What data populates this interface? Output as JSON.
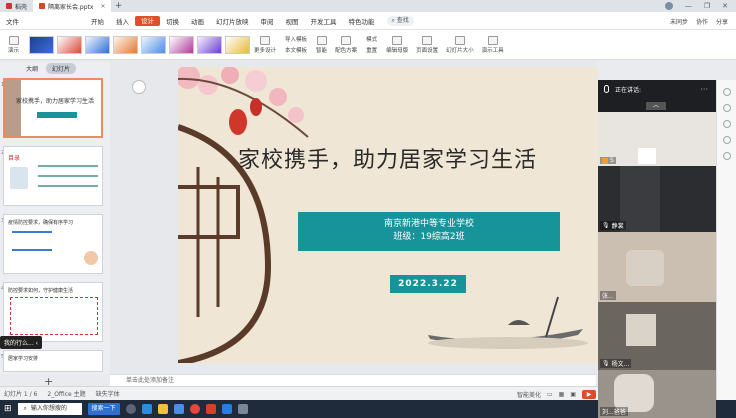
{
  "tabs": [
    {
      "label": "稻壳",
      "active": false
    },
    {
      "label": "隔离家长会.pptx",
      "active": true
    }
  ],
  "menus": [
    "文件",
    "开始",
    "插入",
    "设计",
    "切换",
    "动画",
    "幻灯片放映",
    "审阅",
    "视图",
    "开发工具",
    "特色功能"
  ],
  "active_menu": "设计",
  "search_label": "查找",
  "menu_right": {
    "unsaved": "未同步",
    "collab": "协作",
    "share": "分享"
  },
  "ribbon": {
    "left_label": "演示",
    "more_design": "更多设计",
    "import_template": "导入模板",
    "text_template": "本文模板",
    "smart": "智能",
    "color_scheme": "配色方案",
    "format": "模式",
    "reset": "重置",
    "edit_master": "编辑母版",
    "page_setup": "页面设置",
    "slide_size": "幻灯片大小",
    "show_tools": "演示工具"
  },
  "panel": {
    "outline": "大纲",
    "slides": "幻灯片"
  },
  "thumbnails": [
    {
      "num": "1",
      "title": "家校携手，助力居家学习生活"
    },
    {
      "num": "2",
      "title": "目录"
    },
    {
      "num": "3",
      "title": "疫情防控要求，确保有序学习"
    },
    {
      "num": "4",
      "title": "防控要求如何，守护健康生活"
    },
    {
      "num": "5",
      "title": "居家学习安排"
    }
  ],
  "float_tip": "我的行么...",
  "slide": {
    "title": "家校携手，助力居家学习生活",
    "school": "南京新港中等专业学校",
    "class": "班级：19综高2班",
    "date": "2022.3.22"
  },
  "notes_placeholder": "单击此处添加备注",
  "status": {
    "slide_count": "幻灯片 1 / 6",
    "theme": "2_Office 主题",
    "font_missing": "缺失字体",
    "smart_beautify": "智能美化"
  },
  "meeting": {
    "header": "正在讲话:",
    "participants": [
      {
        "name": "S",
        "label": "s"
      },
      {
        "name": "静裳"
      },
      {
        "name": "张..."
      },
      {
        "name": "杨文..."
      },
      {
        "name": "刘...爸爸"
      }
    ]
  },
  "taskbar": {
    "search_hint": "输入你想搜的",
    "button": "搜索一下"
  },
  "colors": {
    "accent": "#e14e2a",
    "teal": "#17939a",
    "taskbar": "#1f2a3a"
  }
}
